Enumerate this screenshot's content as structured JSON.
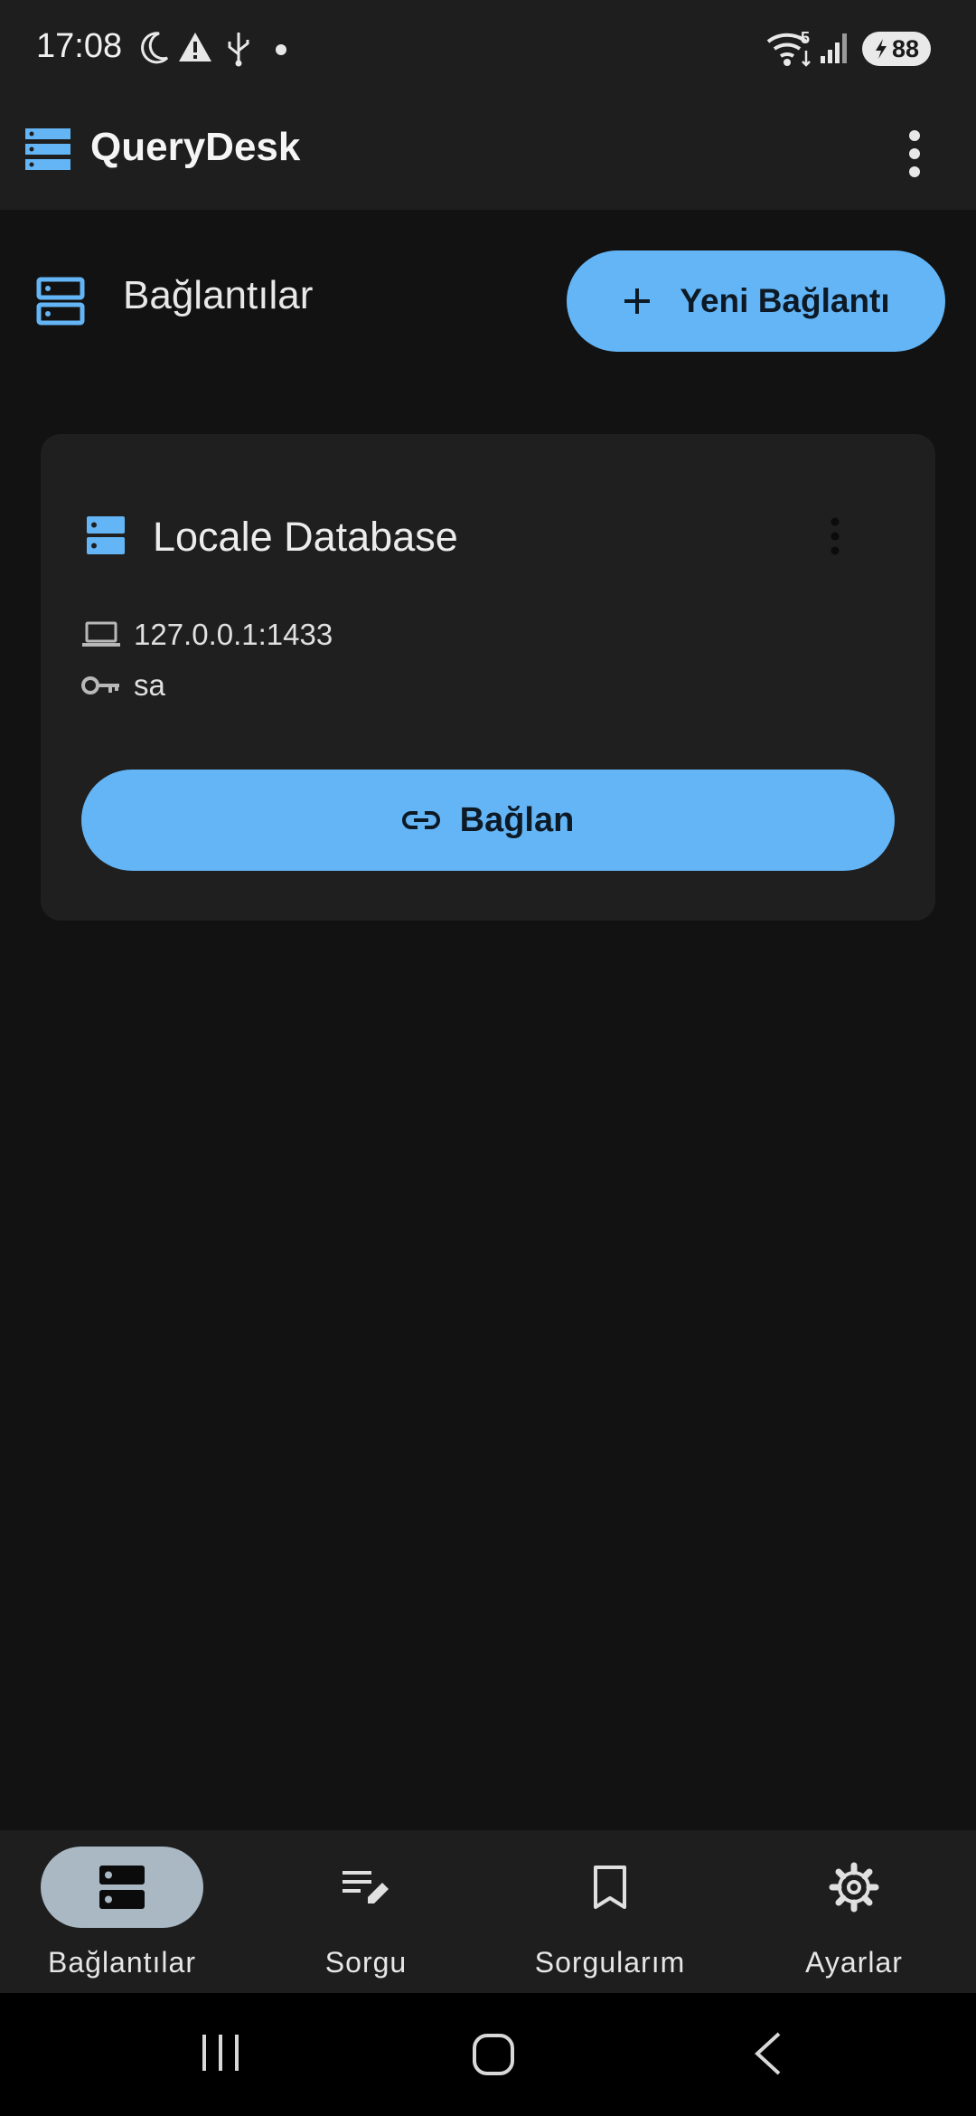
{
  "status_bar": {
    "time": "17:08",
    "battery": "88",
    "network_badge": "5"
  },
  "app_bar": {
    "title": "QueryDesk"
  },
  "connections_header": {
    "title": "Bağlantılar",
    "new_button_label": "Yeni Bağlantı"
  },
  "connections": [
    {
      "name": "Locale Database",
      "host": "127.0.0.1:1433",
      "user": "sa",
      "connect_label": "Bağlan"
    }
  ],
  "bottom_nav": {
    "items": [
      {
        "label": "Bağlantılar",
        "icon": "dns-icon",
        "active": true
      },
      {
        "label": "Sorgu",
        "icon": "edit-note-icon",
        "active": false
      },
      {
        "label": "Sorgularım",
        "icon": "bookmark-icon",
        "active": false
      },
      {
        "label": "Ayarlar",
        "icon": "gear-icon",
        "active": false
      }
    ]
  },
  "colors": {
    "accent": "#64b5f6",
    "background": "#121212",
    "surface": "#1e1e1e",
    "card": "#1f1f1f",
    "active_pill": "#a9b8c3"
  }
}
